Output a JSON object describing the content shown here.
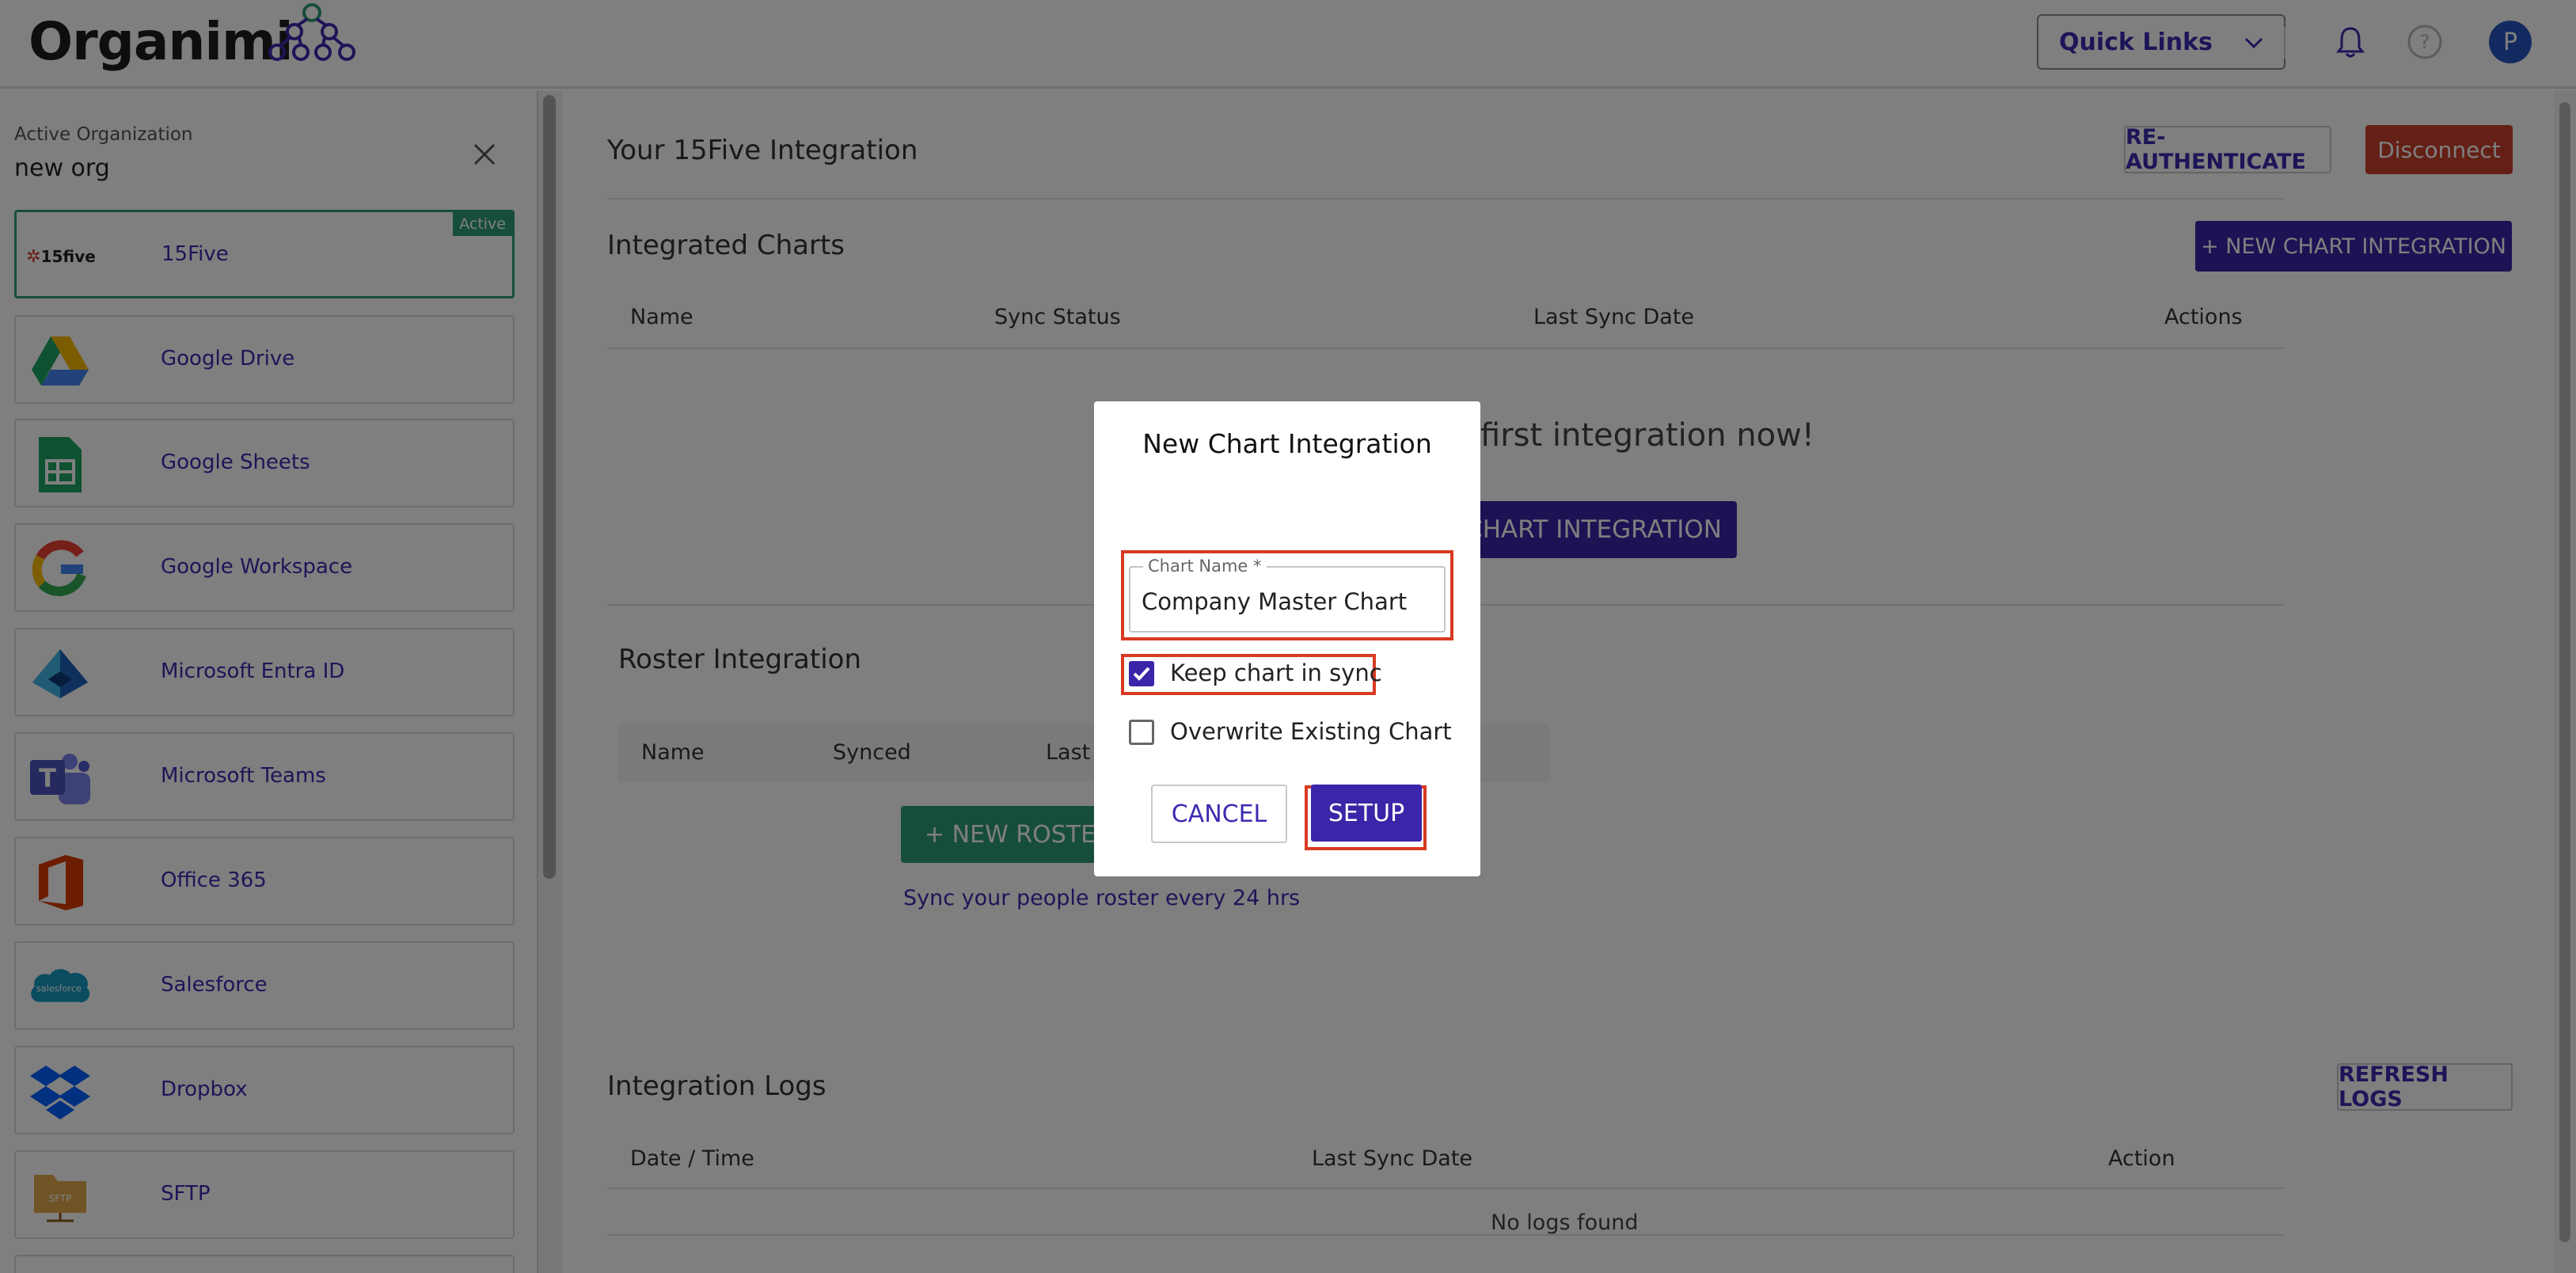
{
  "app": {
    "name": "Organimi"
  },
  "topbar": {
    "quick_links": "Quick Links",
    "avatar_initial": "P"
  },
  "sidebar": {
    "org_label": "Active Organization",
    "org_name": "new org",
    "active_badge": "Active",
    "items": [
      {
        "label": "15Five",
        "logo_text": "15five",
        "active": true
      },
      {
        "label": "Google Drive"
      },
      {
        "label": "Google Sheets"
      },
      {
        "label": "Google Workspace"
      },
      {
        "label": "Microsoft Entra ID"
      },
      {
        "label": "Microsoft Teams"
      },
      {
        "label": "Office 365"
      },
      {
        "label": "Salesforce",
        "logo_text": "salesforce"
      },
      {
        "label": "Dropbox"
      },
      {
        "label": "SFTP",
        "logo_text": "SFTP"
      }
    ]
  },
  "main": {
    "integration_title": "Your 15Five Integration",
    "reauth": "RE-AUTHENTICATE",
    "disconnect": "Disconnect",
    "charts": {
      "title": "Integrated Charts",
      "new_button": "+ NEW CHART INTEGRATION",
      "columns": [
        "Name",
        "Sync Status",
        "Last Sync Date",
        "Actions"
      ],
      "empty_message": "first integration now!",
      "empty_button": "CHART INTEGRATION"
    },
    "roster": {
      "title": "Roster Integration",
      "columns": [
        "Name",
        "Synced",
        "Last S"
      ],
      "new_button": "+ NEW ROSTER",
      "note": "Sync your people roster every 24 hrs"
    },
    "logs": {
      "title": "Integration Logs",
      "refresh": "REFRESH LOGS",
      "columns": [
        "Date / Time",
        "Last Sync Date",
        "Action"
      ],
      "empty": "No logs found"
    }
  },
  "modal": {
    "title": "New Chart Integration",
    "chart_name_label": "Chart Name *",
    "chart_name_value": "Company Master Chart",
    "keep_sync_label": "Keep chart in sync",
    "keep_sync_checked": true,
    "overwrite_label": "Overwrite Existing Chart",
    "overwrite_checked": false,
    "cancel": "CANCEL",
    "setup": "SETUP"
  },
  "colors": {
    "accent": "#3b25a8",
    "danger": "#c9402c",
    "active_border": "#2f9d72",
    "highlight": "#d83a22"
  }
}
